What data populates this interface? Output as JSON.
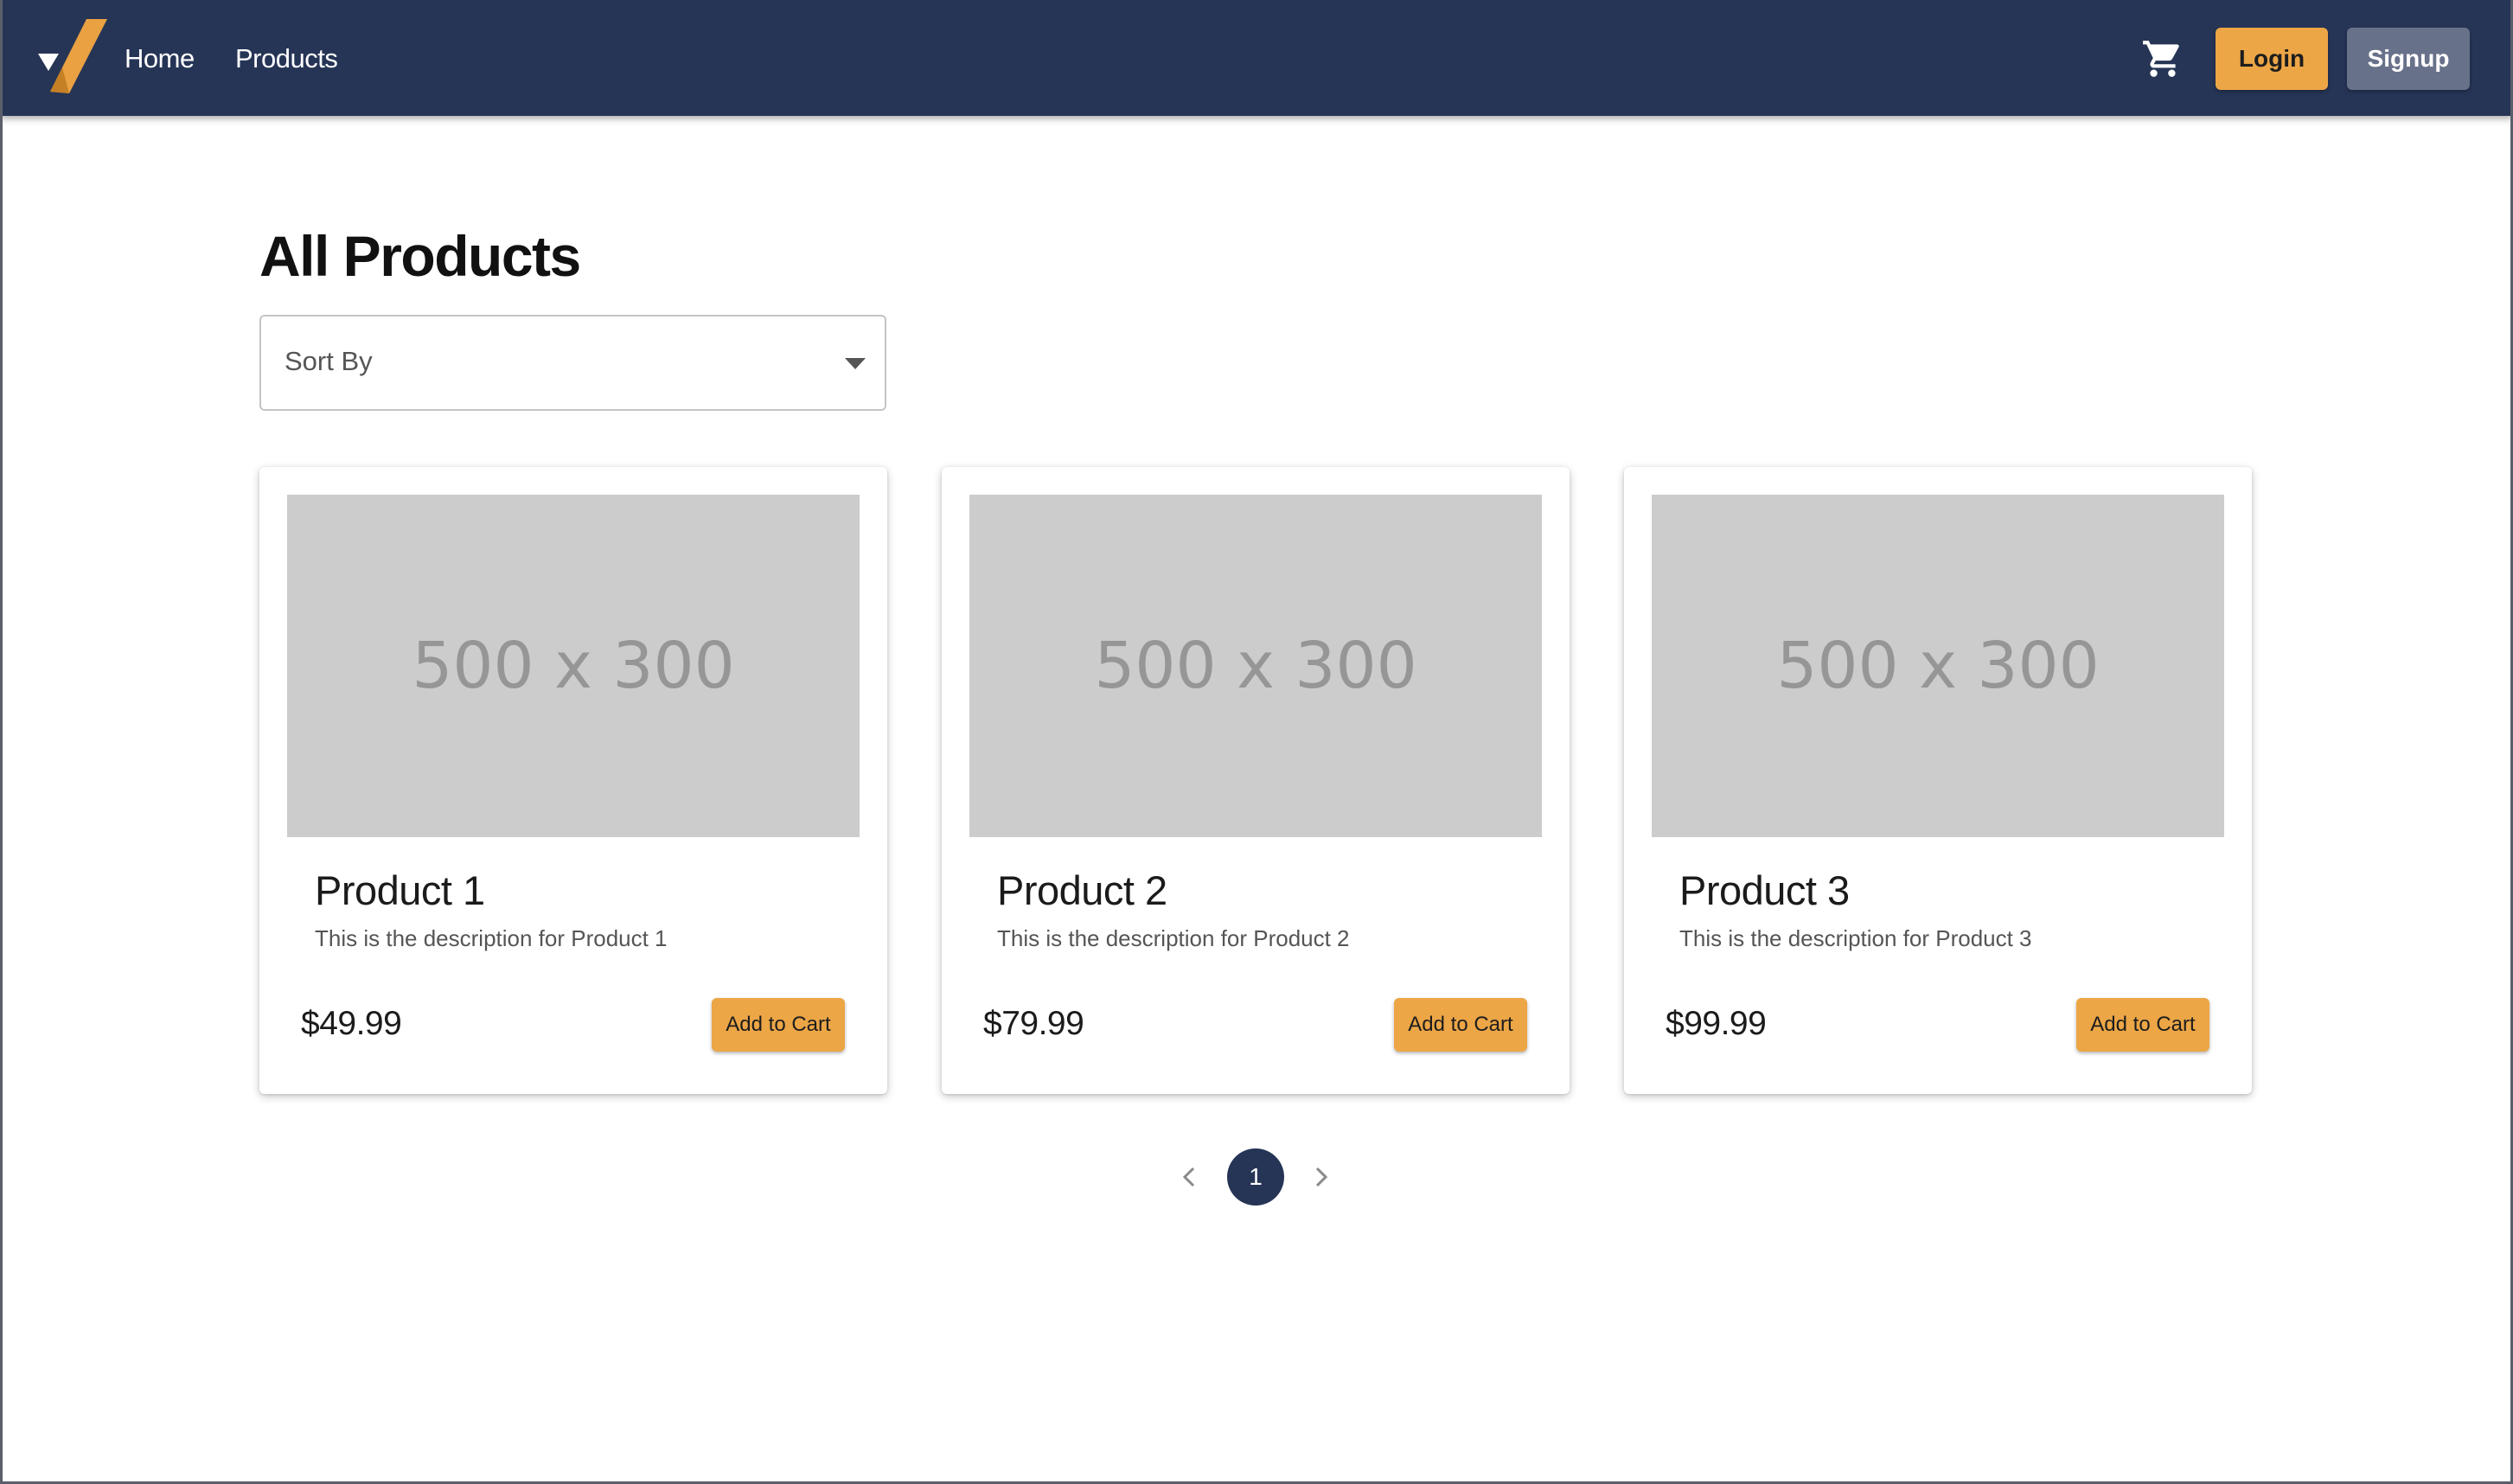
{
  "nav": {
    "links": [
      {
        "label": "Home"
      },
      {
        "label": "Products"
      }
    ],
    "cart_icon": "shopping-cart-icon",
    "login_label": "Login",
    "signup_label": "Signup"
  },
  "main": {
    "title": "All Products",
    "sort": {
      "placeholder": "Sort By",
      "icon": "dropdown-arrow-icon"
    },
    "products": [
      {
        "image_text": "500 x 300",
        "name": "Product 1",
        "description": "This is the description for Product 1",
        "price": "$49.99",
        "button_label": "Add to Cart"
      },
      {
        "image_text": "500 x 300",
        "name": "Product 2",
        "description": "This is the description for Product 2",
        "price": "$79.99",
        "button_label": "Add to Cart"
      },
      {
        "image_text": "500 x 300",
        "name": "Product 3",
        "description": "This is the description for Product 3",
        "price": "$99.99",
        "button_label": "Add to Cart"
      }
    ]
  },
  "pagination": {
    "current_page": "1",
    "prev_icon": "chevron-left-icon",
    "next_icon": "chevron-right-icon"
  },
  "colors": {
    "navbar": "#263556",
    "accent": "#eca646",
    "secondary_button": "#68718a",
    "image_placeholder": "#cccccc"
  }
}
